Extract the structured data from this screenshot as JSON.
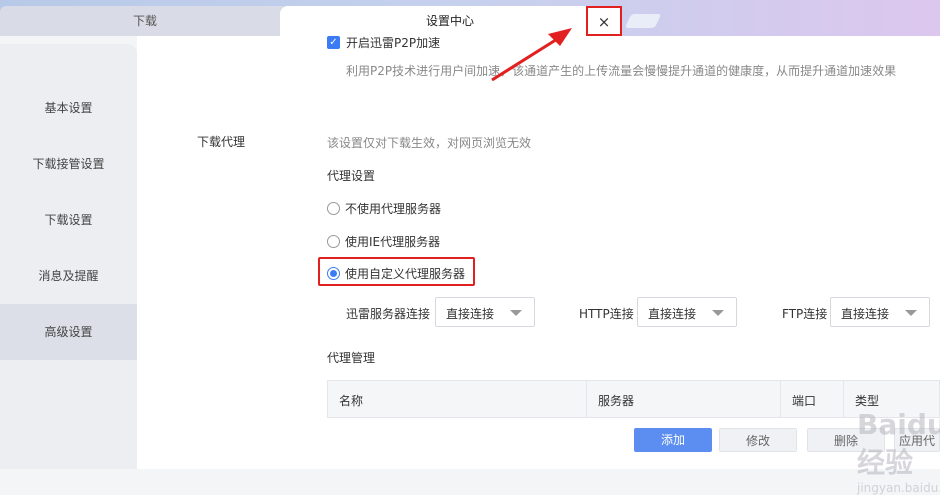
{
  "tabs": {
    "inactive_label": "下载",
    "active_label": "设置中心",
    "close_glyph": "×"
  },
  "sidebar": {
    "items": [
      {
        "label": "基本设置"
      },
      {
        "label": "下载接管设置"
      },
      {
        "label": "下载设置"
      },
      {
        "label": "消息及提醒"
      },
      {
        "label": "高级设置",
        "active": true
      }
    ]
  },
  "p2p": {
    "checkbox_label": "开启迅雷P2P加速",
    "checked": true,
    "description": "利用P2P技术进行用户间加速，该通道产生的上传流量会慢慢提升通道的健康度，从而提升通道加速效果"
  },
  "proxy": {
    "section_label": "下载代理",
    "note": "该设置仅对下载生效，对网页浏览无效",
    "settings_title": "代理设置",
    "options": [
      {
        "label": "不使用代理服务器",
        "checked": false
      },
      {
        "label": "使用IE代理服务器",
        "checked": false
      },
      {
        "label": "使用自定义代理服务器",
        "checked": true
      }
    ],
    "connections": [
      {
        "label": "迅雷服务器连接",
        "value": "直接连接"
      },
      {
        "label": "HTTP连接",
        "value": "直接连接"
      },
      {
        "label": "FTP连接",
        "value": "直接连接"
      }
    ],
    "management_title": "代理管理",
    "table_columns": [
      "名称",
      "服务器",
      "端口",
      "类型"
    ],
    "buttons": {
      "add": "添加",
      "edit": "修改",
      "delete": "删除",
      "apply": "应用代"
    }
  },
  "watermark": {
    "logo_text": "Baidu 经验",
    "url": "jingyan.baidu.com"
  },
  "colors": {
    "accent": "#3b7cf4",
    "highlight": "#e22020",
    "sidebar_active": "#dcdfe7"
  }
}
